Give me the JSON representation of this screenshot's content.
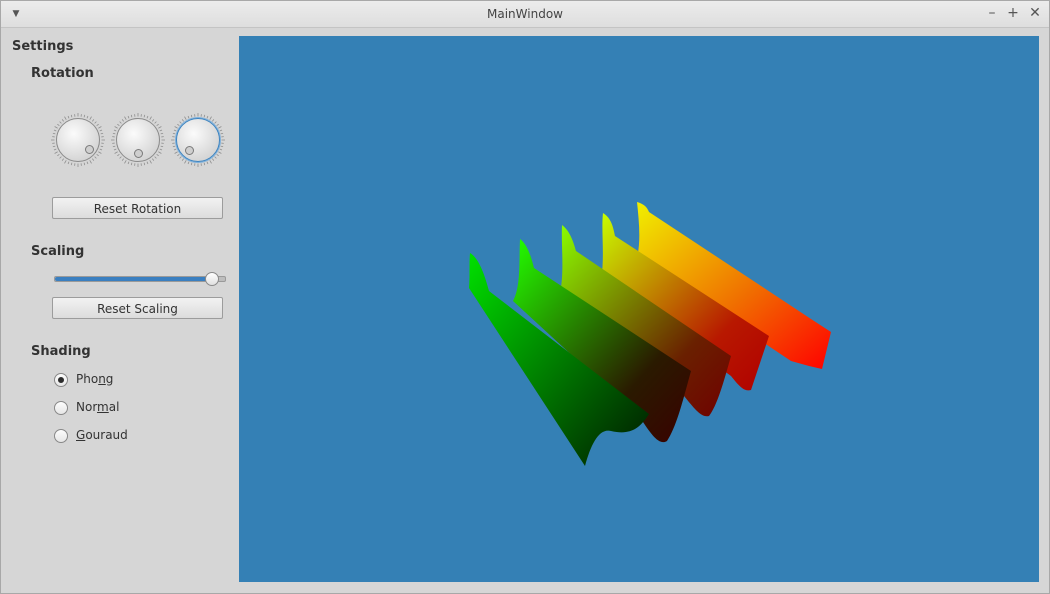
{
  "window": {
    "title": "MainWindow"
  },
  "settings": {
    "title": "Settings",
    "rotation": {
      "title": "Rotation",
      "dials": [
        {
          "name": "x-rotation"
        },
        {
          "name": "y-rotation"
        },
        {
          "name": "z-rotation"
        }
      ],
      "reset_label": "Reset Rotation"
    },
    "scaling": {
      "title": "Scaling",
      "level": 0.93,
      "reset_label": "Reset Scaling"
    },
    "shading": {
      "title": "Shading",
      "options": [
        {
          "label_before": "Pho",
          "mnemonic": "n",
          "label_after": "g",
          "checked": true
        },
        {
          "label_before": "Nor",
          "mnemonic": "m",
          "label_after": "al",
          "checked": false
        },
        {
          "label_before": "",
          "mnemonic": "G",
          "label_after": "ouraud",
          "checked": false
        }
      ]
    }
  },
  "colors": {
    "viewport_background": "#3480b5",
    "accent": "#3a7fc0"
  }
}
